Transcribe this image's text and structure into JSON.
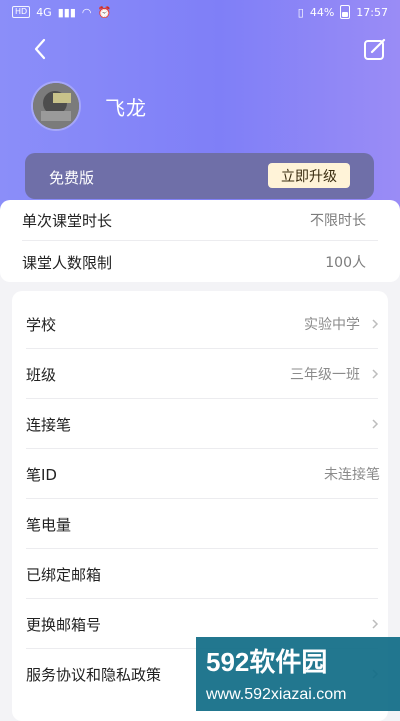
{
  "status": {
    "left_items": [
      "HD",
      "4G"
    ],
    "battery": "44%",
    "time": "17:57"
  },
  "header": {
    "username": "飞龙"
  },
  "vip": {
    "version_label": "免费版",
    "upgrade_label": "立即升级"
  },
  "limits": [
    {
      "label": "单次课堂时长",
      "value": "不限时长"
    },
    {
      "label": "课堂人数限制",
      "value": "100人"
    }
  ],
  "settings": [
    {
      "label": "学校",
      "value": "实验中学",
      "has_chevron": true
    },
    {
      "label": "班级",
      "value": "三年级一班",
      "has_chevron": true
    },
    {
      "label": "连接笔",
      "value": "",
      "has_chevron": true
    },
    {
      "label": "笔ID",
      "value": "未连接笔",
      "has_chevron": false
    },
    {
      "label": "笔电量",
      "value": "",
      "has_chevron": false
    },
    {
      "label": "已绑定邮箱",
      "value": "",
      "has_chevron": false
    },
    {
      "label": "更换邮箱号",
      "value": "",
      "has_chevron": true
    },
    {
      "label": "服务协议和隐私政策",
      "value": "",
      "has_chevron": true
    }
  ],
  "watermark": {
    "brand": "592软件园",
    "url": "www.592xiazai.com"
  },
  "colors": {
    "header_gradient_start": "#8b8ef9",
    "header_gradient_end": "#9a8cf6",
    "vip_card": "#6f6fa8",
    "upgrade_button": "#fff3d8"
  }
}
